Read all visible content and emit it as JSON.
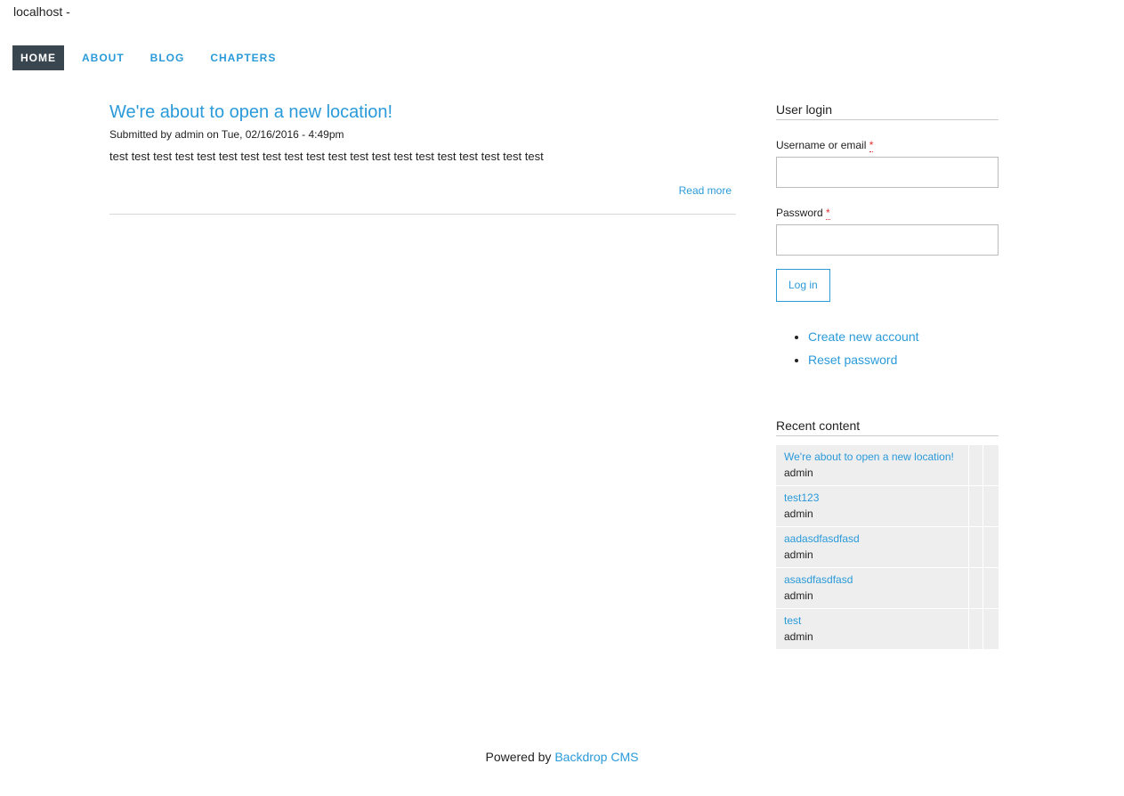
{
  "site": {
    "name": "localhost -"
  },
  "nav": {
    "items": [
      {
        "label": "HOME",
        "active": true
      },
      {
        "label": "ABOUT",
        "active": false
      },
      {
        "label": "BLOG",
        "active": false
      },
      {
        "label": "CHAPTERS",
        "active": false
      }
    ]
  },
  "article": {
    "title": "We're about to open a new location!",
    "submitted": "Submitted by admin on Tue, 02/16/2016 - 4:49pm",
    "body": "test test test test test test test test test test test test test test test test test test test test",
    "read_more": "Read more"
  },
  "login": {
    "title": "User login",
    "username_label": "Username or email",
    "password_label": "Password",
    "required_mark": "*",
    "username_value": "",
    "password_value": "",
    "button": "Log in",
    "links": [
      "Create new account",
      "Reset password"
    ]
  },
  "recent": {
    "title": "Recent content",
    "items": [
      {
        "title": "We're about to open a new location!",
        "author": "admin"
      },
      {
        "title": "test123",
        "author": "admin"
      },
      {
        "title": "aadasdfasdfasd",
        "author": "admin"
      },
      {
        "title": "asasdfasdfasd",
        "author": "admin"
      },
      {
        "title": "test",
        "author": "admin"
      }
    ]
  },
  "footer": {
    "prefix": "Powered by",
    "link": "Backdrop CMS"
  },
  "colors": {
    "accent": "#2a9ad9",
    "nav_active_bg": "#3a464f",
    "required": "#e03030",
    "table_bg": "#eeeeee"
  }
}
